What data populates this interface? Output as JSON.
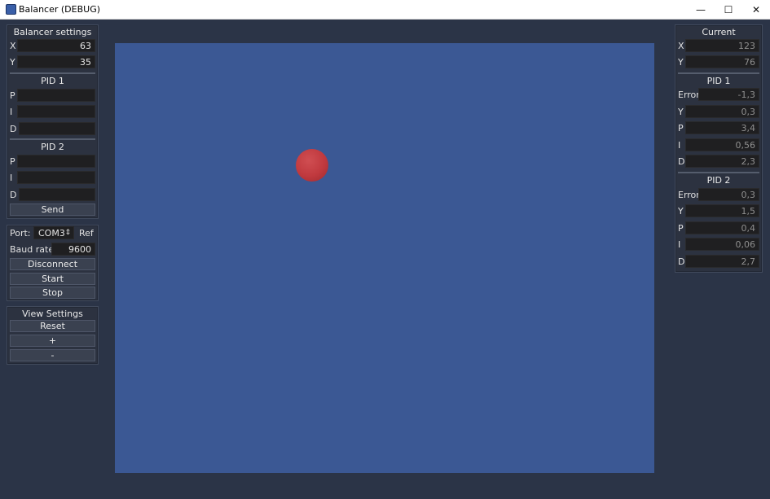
{
  "window": {
    "title": "Balancer (DEBUG)",
    "minimize": "—",
    "maximize": "☐",
    "close": "✕"
  },
  "balancer": {
    "title": "Balancer settings",
    "x_label": "X",
    "x_value": "63",
    "y_label": "Y",
    "y_value": "35",
    "pid1": {
      "title": "PID 1",
      "p_label": "P",
      "i_label": "I",
      "d_label": "D",
      "p": "",
      "i": "",
      "d": ""
    },
    "pid2": {
      "title": "PID 2",
      "p_label": "P",
      "i_label": "I",
      "d_label": "D",
      "p": "",
      "i": "",
      "d": ""
    },
    "send": "Send"
  },
  "connection": {
    "port_label": "Port:",
    "port_value": "COM3",
    "ref_label": "Ref",
    "baud_label": "Baud rate:",
    "baud_value": "9600",
    "disconnect": "Disconnect",
    "start": "Start",
    "stop": "Stop"
  },
  "view": {
    "title": "View Settings",
    "reset": "Reset",
    "zoom_in": "+",
    "zoom_out": "-"
  },
  "current": {
    "title": "Current",
    "x_label": "X",
    "x_value": "123",
    "y_label": "Y",
    "y_value": "76",
    "pid1": {
      "title": "PID 1",
      "error_label": "Error",
      "error": "-1,3",
      "y_label": "Y",
      "y": "0,3",
      "p_label": "P",
      "p": "3,4",
      "i_label": "I",
      "i": "0,56",
      "d_label": "D",
      "d": "2,3"
    },
    "pid2": {
      "title": "PID 2",
      "error_label": "Error",
      "error": "0,3",
      "y_label": "Y",
      "y": "1,5",
      "p_label": "P",
      "p": "0,4",
      "i_label": "I",
      "i": "0,06",
      "d_label": "D",
      "d": "2,7"
    }
  },
  "colors": {
    "background": "#2b3447",
    "canvas": "#3b5894",
    "ball": "#c0393e"
  }
}
